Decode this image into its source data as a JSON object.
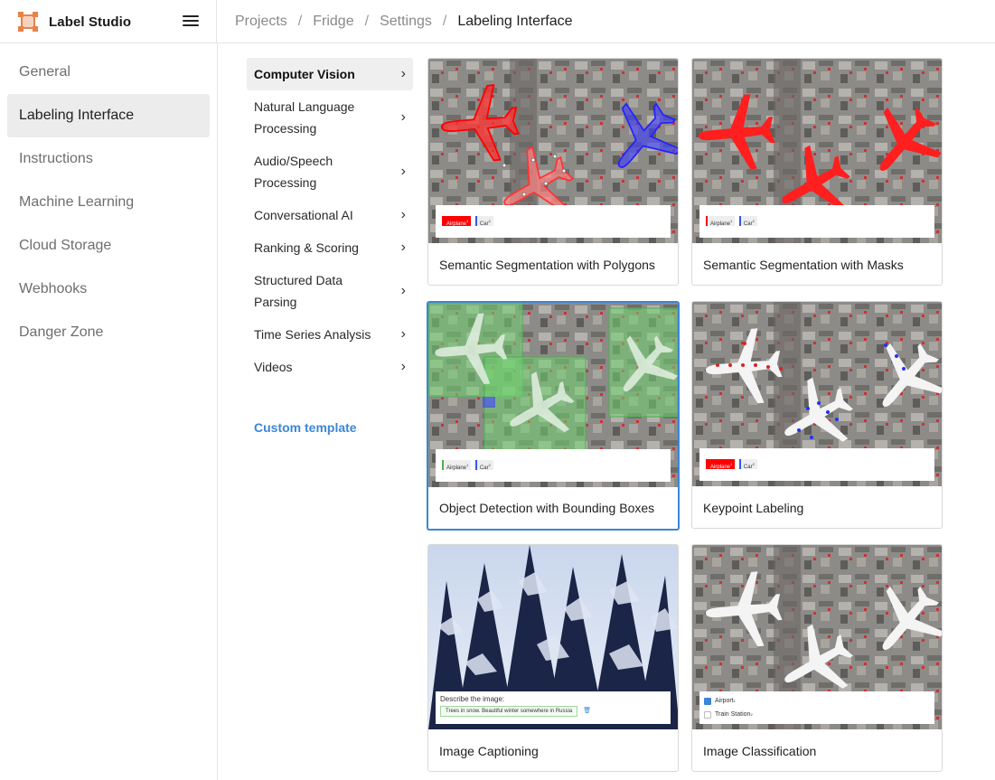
{
  "app": {
    "name": "Label Studio"
  },
  "breadcrumb": [
    "Projects",
    "Fridge",
    "Settings",
    "Labeling Interface"
  ],
  "sidebar": {
    "items": [
      {
        "label": "General"
      },
      {
        "label": "Labeling Interface"
      },
      {
        "label": "Instructions"
      },
      {
        "label": "Machine Learning"
      },
      {
        "label": "Cloud Storage"
      },
      {
        "label": "Webhooks"
      },
      {
        "label": "Danger Zone"
      }
    ]
  },
  "categories": {
    "items": [
      {
        "label": "Computer Vision"
      },
      {
        "label": "Natural Language Processing"
      },
      {
        "label": "Audio/Speech Processing"
      },
      {
        "label": "Conversational AI"
      },
      {
        "label": "Ranking & Scoring"
      },
      {
        "label": "Structured Data Parsing"
      },
      {
        "label": "Time Series Analysis"
      },
      {
        "label": "Videos"
      }
    ],
    "custom_label": "Custom template"
  },
  "templates": [
    {
      "title": "Semantic Segmentation with Polygons",
      "labels": [
        "Airplane",
        "Car"
      ]
    },
    {
      "title": "Semantic Segmentation with Masks",
      "labels": [
        "Airplane",
        "Car"
      ]
    },
    {
      "title": "Object Detection with Bounding Boxes",
      "labels": [
        "Airplane",
        "Car"
      ]
    },
    {
      "title": "Keypoint Labeling",
      "labels": [
        "Airplane",
        "Car"
      ]
    },
    {
      "title": "Image Captioning",
      "caption_prompt": "Describe the image:",
      "caption_text": "Trees in snow. Beautiful winter somewhere in Russia"
    },
    {
      "title": "Image Classification",
      "choices": [
        "Airport",
        "Train Station"
      ]
    }
  ],
  "label_hotkeys": [
    "1",
    "2"
  ],
  "colors": {
    "accent": "#3b86d8",
    "logo": "#e8824a",
    "label_airplane": "#ff0000",
    "label_car": "#3355ee",
    "bbox_green": "#6fd36f"
  },
  "icons": {
    "logo": "label-studio-logo-icon",
    "menu": "hamburger-menu-icon",
    "chevron": "chevron-right-icon",
    "trash": "trash-icon",
    "checkbox": "checkbox-icon"
  }
}
